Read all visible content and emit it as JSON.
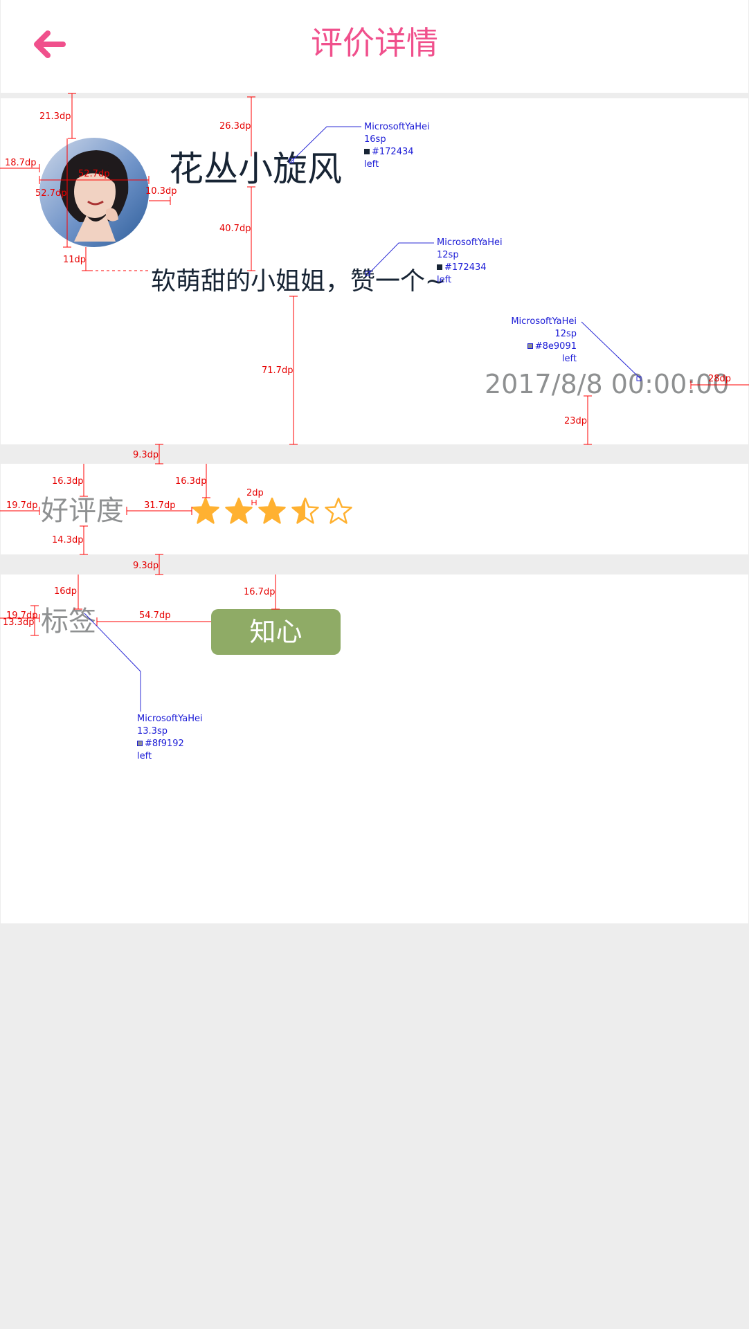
{
  "header": {
    "title": "评价详情",
    "back_icon": "arrow-left-icon",
    "accent_color": "#f0508c"
  },
  "profile": {
    "avatar_icon": "user-avatar",
    "name": "花丛小旋风",
    "comment": "软萌甜的小姐姐，赞一个~",
    "date": "2017/8/8 00:00:00"
  },
  "rating": {
    "label": "好评度",
    "value": 3.5,
    "max": 5,
    "star_color": "#ffb131"
  },
  "tags": {
    "label": "标签",
    "items": [
      {
        "text": "知心",
        "color": "#8fab66"
      }
    ]
  },
  "annotations": {
    "dims": {
      "d1": "21.3dp",
      "d2": "26.3dp",
      "d3": "18.7dp",
      "d4": "52.7dp",
      "d5": "52.7dp",
      "d6": "10.3dp",
      "d7": "40.7dp",
      "d8": "11dp",
      "d9": "71.7dp",
      "d10": "28dp",
      "d11": "23dp",
      "d12": "9.3dp",
      "d13": "16.3dp",
      "d14": "16.3dp",
      "d15": "2dp",
      "d16": "19.7dp",
      "d17": "31.7dp",
      "d18": "14.3dp",
      "d19": "9.3dp",
      "d20": "16dp",
      "d21": "16.7dp",
      "d22": "19.7dp",
      "d23": "13.3dp",
      "d24": "54.7dp"
    },
    "specs": {
      "name_spec": {
        "font": "MicrosoftYaHei",
        "size": "16sp",
        "color": "#172434",
        "align": "left"
      },
      "comment_spec": {
        "font": "MicrosoftYaHei",
        "size": "12sp",
        "color": "#172434",
        "align": "left"
      },
      "date_spec": {
        "font": "MicrosoftYaHei",
        "size": "12sp",
        "color": "#8e9091",
        "align": "left"
      },
      "label_spec": {
        "font": "MicrosoftYaHei",
        "size": "13.3sp",
        "color": "#8f9192",
        "align": "left"
      }
    }
  }
}
